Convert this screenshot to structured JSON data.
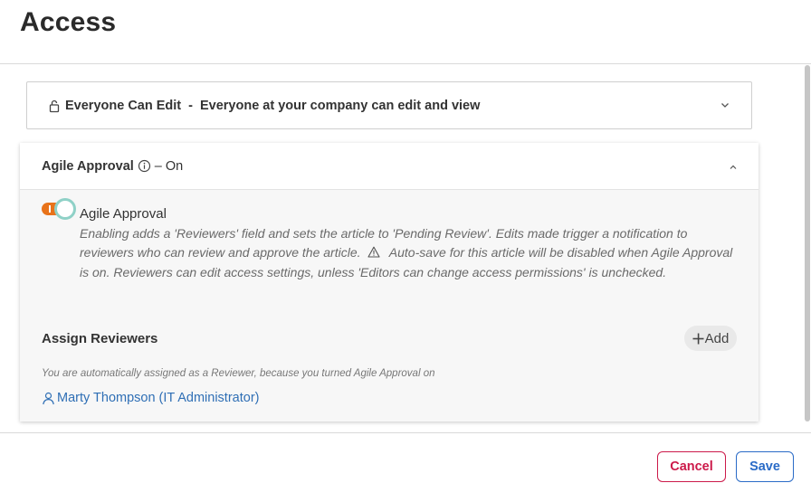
{
  "page": {
    "title": "Access"
  },
  "access_select": {
    "label": "Everyone Can Edit",
    "separator": "-",
    "description": "Everyone at your company can edit and view"
  },
  "agile_panel": {
    "title": "Agile Approval",
    "state": "– On",
    "toggle": {
      "enabled": true,
      "accent": "#e8731a"
    },
    "toggle_label": "Agile Approval",
    "description_part1": "Enabling adds a 'Reviewers' field and sets the article to 'Pending Review'. Edits made trigger a notification to reviewers who can review and approve the article.",
    "description_part2": "Auto-save for this article will be disabled when Agile Approval is on. Reviewers can edit access settings, unless 'Editors can change access permissions' is unchecked.",
    "assign_title": "Assign Reviewers",
    "add_label": "Add",
    "auto_note": "You are automatically assigned as a Reviewer, because you turned Agile Approval on",
    "reviewer_name": "Marty Thompson (IT Administrator)"
  },
  "footer": {
    "cancel_label": "Cancel",
    "save_label": "Save"
  },
  "colors": {
    "cancel": "#cc1a4a",
    "save": "#2a6bc7",
    "link": "#2f6fb5"
  }
}
